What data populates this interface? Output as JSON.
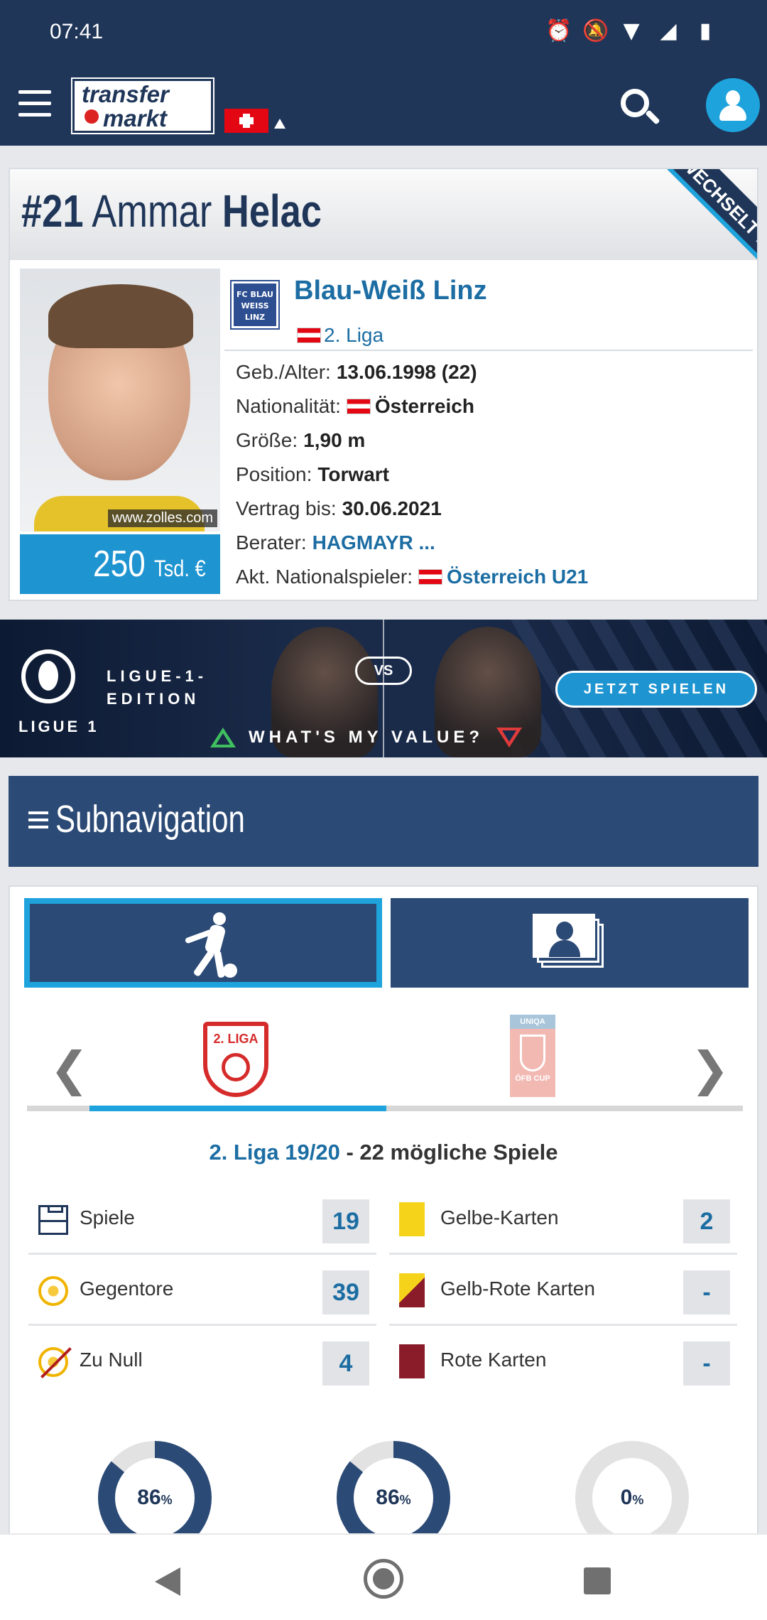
{
  "status_bar": {
    "time": "07:41",
    "icons": [
      "alarm-icon",
      "notifications-off-icon",
      "wifi-icon",
      "signal-icon",
      "battery-icon"
    ]
  },
  "header": {
    "logo_line1": "transfer",
    "logo_line2": "markt",
    "region_flag": "Switzerland"
  },
  "player": {
    "number": "#21",
    "first_name": "Ammar",
    "last_name": "Helac",
    "ribbon": "WECHSELT ...",
    "photo_credit": "www.zolles.com",
    "market_value_amount": "250",
    "market_value_unit": "Tsd. €",
    "club_logo_text": "FC BLAU WEISS LINZ",
    "club": "Blau-Weiß Linz",
    "league": "2. Liga",
    "facts": {
      "birth_label": "Geb./Alter:",
      "birth_value": "13.06.1998 (22)",
      "nationality_label": "Nationalität:",
      "nationality_value": "Österreich",
      "height_label": "Größe:",
      "height_value": "1,90 m",
      "position_label": "Position:",
      "position_value": "Torwart",
      "contract_label": "Vertrag bis:",
      "contract_value": "30.06.2021",
      "agent_label": "Berater:",
      "agent_value": "HAGMAYR ...",
      "national_label": "Akt. Nationalspieler:",
      "national_value": "Österreich U21"
    }
  },
  "ad": {
    "brand": "LIGUE 1",
    "edition_line1": "LIGUE-1-",
    "edition_line2": "EDITION",
    "vs": "VS",
    "cta": "JETZT SPIELEN",
    "tagline": "WHAT'S MY VALUE?"
  },
  "subnav": {
    "label": "Subnavigation"
  },
  "stats": {
    "comp1_logo_text": "2. LIGA",
    "comp2_logo_top": "UNIQA",
    "comp2_logo_bottom": "ÖFB CUP",
    "season_link": "2. Liga 19/20",
    "season_suffix": " - 22 mögliche Spiele",
    "rows": {
      "spiele_label": "Spiele",
      "spiele_value": "19",
      "gegentore_label": "Gegentore",
      "gegentore_value": "39",
      "zunull_label": "Zu Null",
      "zunull_value": "4",
      "gelb_label": "Gelbe-Karten",
      "gelb_value": "2",
      "gelbrot_label": "Gelb-Rote Karten",
      "gelbrot_value": "-",
      "rot_label": "Rote Karten",
      "rot_value": "-"
    },
    "donuts": [
      {
        "value": "86",
        "unit": "%",
        "fraction": 0.86
      },
      {
        "value": "86",
        "unit": "%",
        "fraction": 0.86
      },
      {
        "value": "0",
        "unit": "%",
        "fraction": 0
      }
    ]
  },
  "colors": {
    "header": "#1f3659",
    "accent": "#1ea3dc",
    "link": "#1c6da3",
    "subnav": "#2b4a76"
  }
}
